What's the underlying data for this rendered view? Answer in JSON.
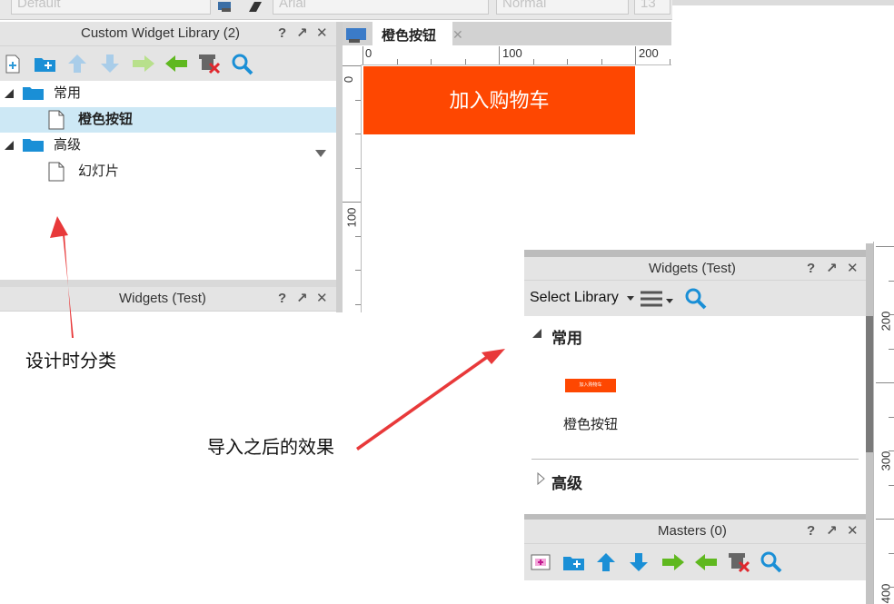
{
  "toolbar_top": {
    "style_field": "Default",
    "font_field": "Arial",
    "weight_field": "Normal",
    "size_field": "13"
  },
  "left_panel": {
    "title": "Custom Widget Library (2)",
    "ctrl_help": "?",
    "ctrl_popout": "↗",
    "ctrl_close": "✕",
    "tree": [
      {
        "label": "常用",
        "type": "folder"
      },
      {
        "label": "橙色按钮",
        "type": "page"
      },
      {
        "label": "高级",
        "type": "folder"
      },
      {
        "label": "幻灯片",
        "type": "page"
      }
    ],
    "sub_panel_title": "Widgets (Test)"
  },
  "canvas": {
    "tab_label": "橙色按钮",
    "tab_close": "✕",
    "ruler_h_labels": [
      "0",
      "100",
      "200"
    ],
    "ruler_v_labels": [
      "0",
      "100"
    ],
    "button_text": "加入购物车",
    "button_color": "#fe4701"
  },
  "annotations": {
    "design_label": "设计时分类",
    "import_label": "导入之后的效果",
    "arrow_color": "#e8393a"
  },
  "right_panel": {
    "title": "Widgets (Test)",
    "ctrl_help": "?",
    "ctrl_popout": "↗",
    "ctrl_close": "✕",
    "select_library": "Select Library",
    "group_common": "常用",
    "widget_label": "橙色按钮",
    "thumb_text": "加入购物车",
    "group_advanced": "高级",
    "right_ruler_labels": [
      "200",
      "300",
      "400"
    ]
  },
  "masters_panel": {
    "title": "Masters (0)",
    "ctrl_help": "?",
    "ctrl_popout": "↗",
    "ctrl_close": "✕"
  }
}
